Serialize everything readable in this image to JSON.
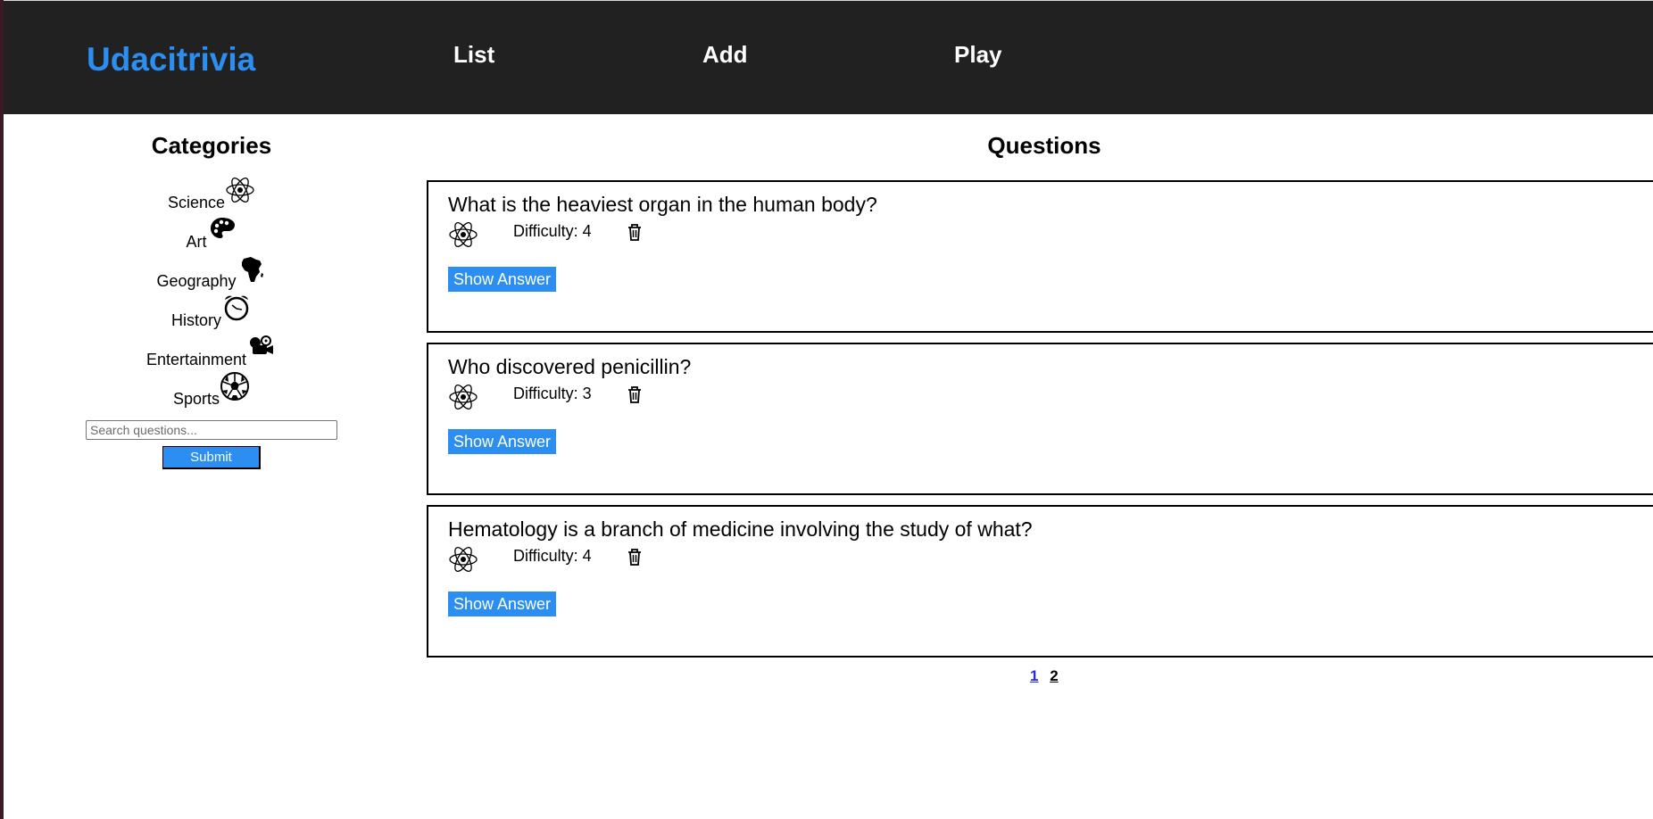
{
  "header": {
    "brand": "Udacitrivia",
    "nav": [
      "List",
      "Add",
      "Play"
    ]
  },
  "sidebar": {
    "title": "Categories",
    "categories": [
      {
        "label": "Science",
        "icon": "science-atom-icon"
      },
      {
        "label": "Art",
        "icon": "art-palette-icon"
      },
      {
        "label": "Geography",
        "icon": "geography-africa-icon"
      },
      {
        "label": "History",
        "icon": "history-alarm-clock-icon"
      },
      {
        "label": "Entertainment",
        "icon": "entertainment-projector-icon"
      },
      {
        "label": "Sports",
        "icon": "sports-soccer-ball-icon"
      }
    ],
    "search": {
      "placeholder": "Search questions...",
      "value": "",
      "submit_label": "Submit"
    }
  },
  "main": {
    "title": "Questions",
    "questions": [
      {
        "text": "What is the heaviest organ in the human body?",
        "difficulty": "Difficulty: 4",
        "category_icon": "science-atom-icon",
        "button": "Show Answer"
      },
      {
        "text": "Who discovered penicillin?",
        "difficulty": "Difficulty: 3",
        "category_icon": "science-atom-icon",
        "button": "Show Answer"
      },
      {
        "text": "Hematology is a branch of medicine involving the study of what?",
        "difficulty": "Difficulty: 4",
        "category_icon": "science-atom-icon",
        "button": "Show Answer"
      }
    ],
    "pagination": [
      "1",
      "2"
    ],
    "current_page": "1"
  },
  "colors": {
    "header_bg": "#212121",
    "brand": "#2b8ef0",
    "button": "#2b8ef0",
    "active_page": "#2a2ad6"
  }
}
